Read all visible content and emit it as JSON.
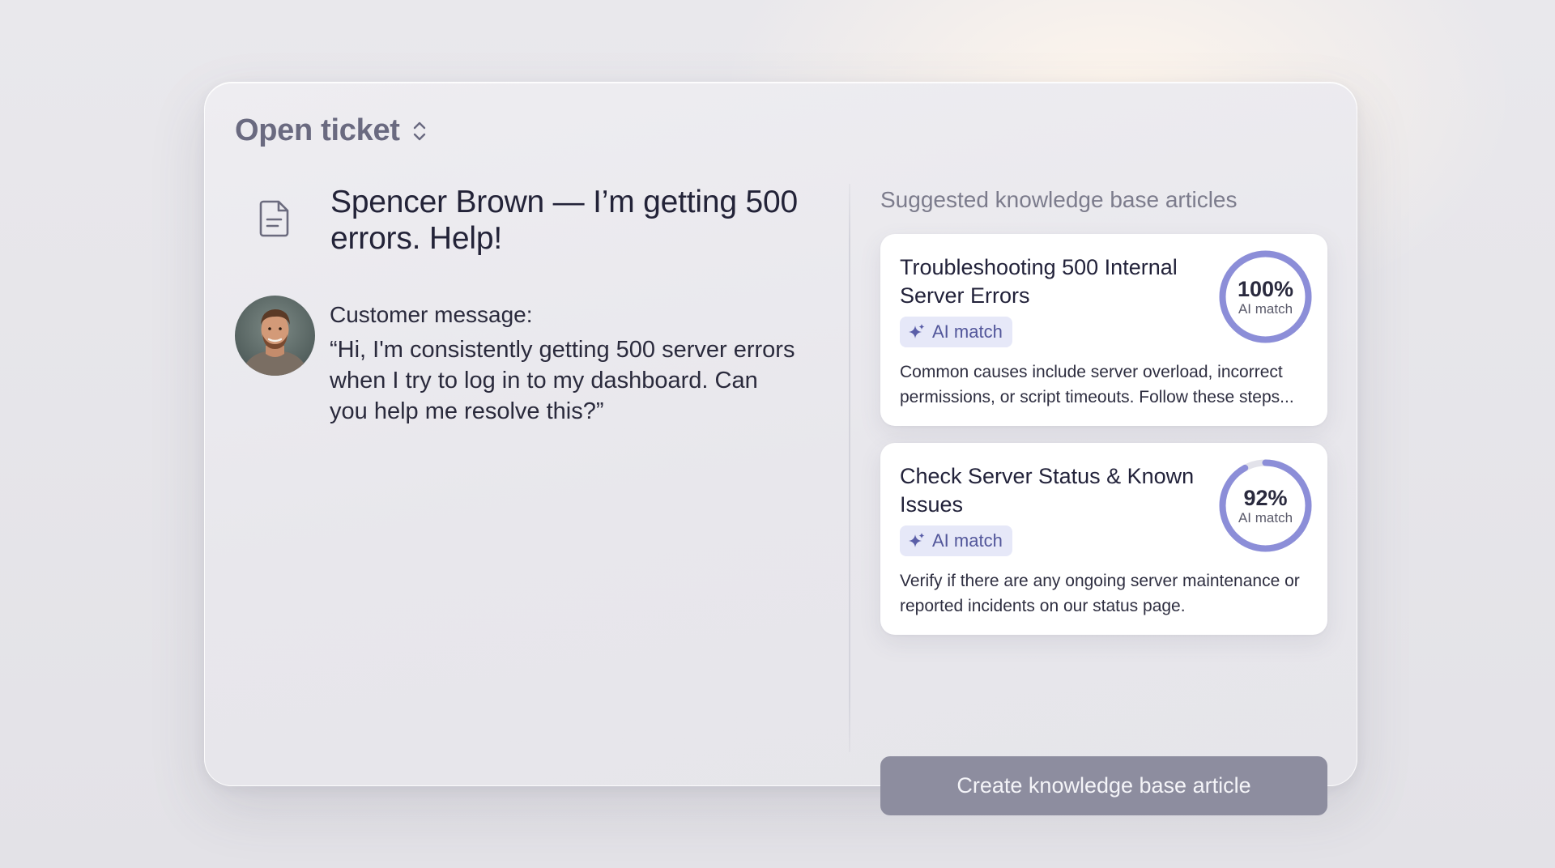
{
  "header": {
    "title": "Open ticket"
  },
  "ticket": {
    "subject": "Spencer Brown — I’m getting 500 errors. Help!",
    "message_label": "Customer message:",
    "message_text": "“Hi, I'm consistently getting 500 server errors when I try to log in to my dashboard. Can you help me resolve this?”"
  },
  "suggestions": {
    "heading": "Suggested knowledge base articles",
    "articles": [
      {
        "title": "Troubleshooting 500 Internal Server Errors",
        "badge": "AI match",
        "description": "Common causes include server overload, incorrect permissions, or script timeouts. Follow these steps...",
        "match_percent_label": "100%",
        "match_value": 1.0,
        "match_sub": "AI match"
      },
      {
        "title": "Check Server Status & Known Issues",
        "badge": "AI match",
        "description": "Verify if there are any ongoing server maintenance or reported incidents on our status page.",
        "match_percent_label": "92%",
        "match_value": 0.92,
        "match_sub": "AI match"
      }
    ],
    "cta_label": "Create knowledge base article"
  },
  "colors": {
    "ring_fill": "#8c8ed8",
    "ring_track": "#e2e2ea",
    "cta_bg": "#8d8d9f",
    "badge_bg": "#e6e8f8"
  },
  "icons": {
    "header": "chevron-up-down-icon",
    "subject": "document-icon",
    "badge": "sparkle-icon"
  }
}
